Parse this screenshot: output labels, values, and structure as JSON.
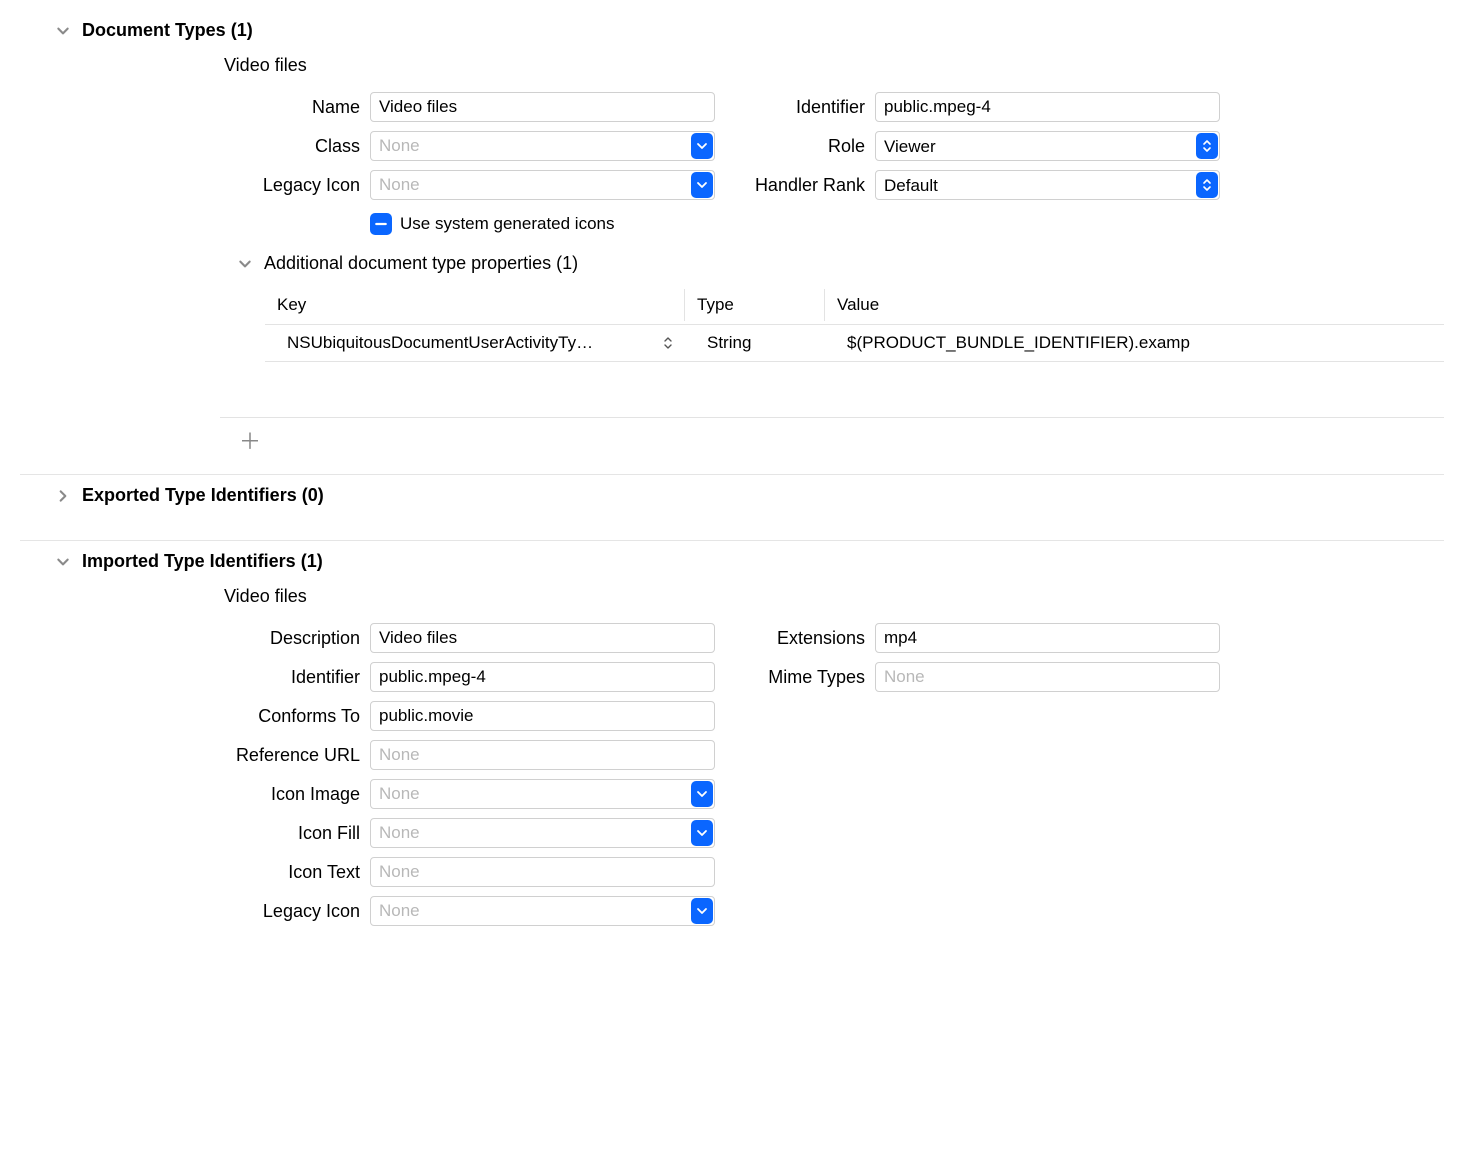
{
  "docTypes": {
    "header": "Document Types (1)",
    "subTitle": "Video files",
    "left": {
      "nameLabel": "Name",
      "nameValue": "Video files",
      "classLabel": "Class",
      "classPlaceholder": "None",
      "legacyIconLabel": "Legacy Icon",
      "legacyIconPlaceholder": "None",
      "systemIconsLabel": "Use system generated icons"
    },
    "right": {
      "identifierLabel": "Identifier",
      "identifierValue": "public.mpeg-4",
      "roleLabel": "Role",
      "roleValue": "Viewer",
      "handlerLabel": "Handler Rank",
      "handlerValue": "Default"
    },
    "additional": {
      "header": "Additional document type properties (1)",
      "headKey": "Key",
      "headType": "Type",
      "headValue": "Value",
      "row": {
        "key": "NSUbiquitousDocumentUserActivityTy…",
        "type": "String",
        "value": "$(PRODUCT_BUNDLE_IDENTIFIER).examp"
      }
    }
  },
  "exported": {
    "header": "Exported Type Identifiers (0)"
  },
  "imported": {
    "header": "Imported Type Identifiers (1)",
    "subTitle": "Video files",
    "left": {
      "descriptionLabel": "Description",
      "descriptionValue": "Video files",
      "identifierLabel": "Identifier",
      "identifierValue": "public.mpeg-4",
      "conformsToLabel": "Conforms To",
      "conformsToValue": "public.movie",
      "referenceUrlLabel": "Reference URL",
      "referenceUrlPlaceholder": "None",
      "iconImageLabel": "Icon Image",
      "iconImagePlaceholder": "None",
      "iconFillLabel": "Icon Fill",
      "iconFillPlaceholder": "None",
      "iconTextLabel": "Icon Text",
      "iconTextPlaceholder": "None",
      "legacyIconLabel": "Legacy Icon",
      "legacyIconPlaceholder": "None"
    },
    "right": {
      "extensionsLabel": "Extensions",
      "extensionsValue": "mp4",
      "mimeTypesLabel": "Mime Types",
      "mimeTypesPlaceholder": "None"
    }
  }
}
